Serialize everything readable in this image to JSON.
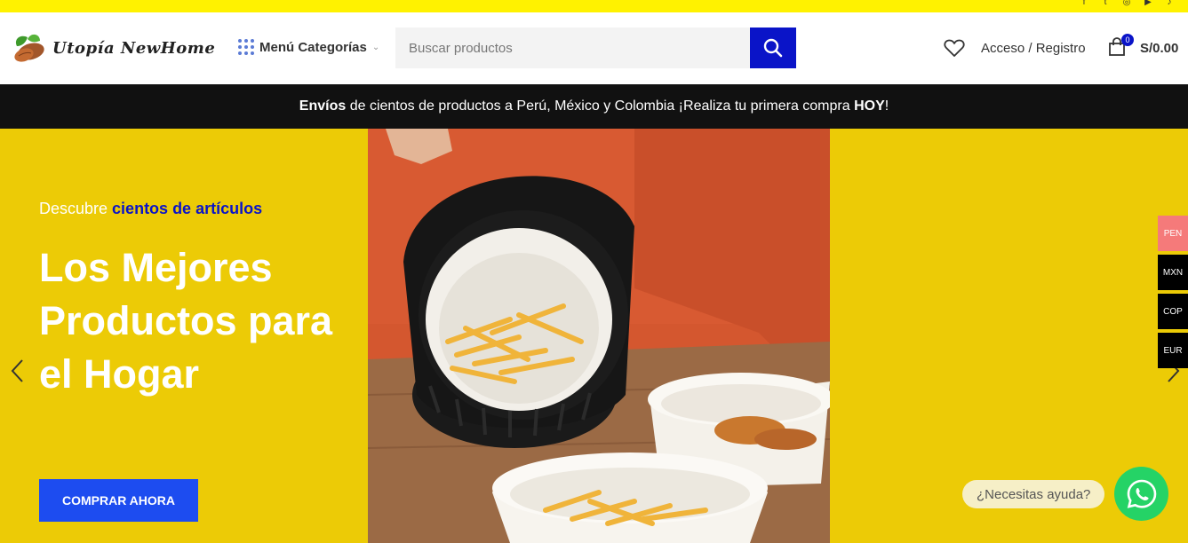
{
  "topbar": {
    "social_icons": [
      "facebook-icon",
      "twitter-icon",
      "instagram-icon",
      "youtube-icon",
      "tiktok-icon"
    ],
    "background": "#fff200"
  },
  "header": {
    "logo_text": "Utopía NewHome",
    "menu_label": "Menú Categorías",
    "search_placeholder": "Buscar productos",
    "login_label": "Acceso / Registro",
    "cart_count": "0",
    "cart_total": "S/0.00",
    "accent": "#0a14c8"
  },
  "promo": {
    "strong_start": "Envíos",
    "middle": " de cientos de productos a Perú, México y Colombia ¡Realiza tu primera compra ",
    "strong_end": "HOY",
    "tail": "!"
  },
  "hero": {
    "kicker_plain": "Descubre ",
    "kicker_highlight": "cientos de artículos",
    "title": "Los Mejores Productos para el Hogar",
    "cta_label": "COMPRAR AHORA",
    "background": "#eccb06"
  },
  "currencies": [
    {
      "code": "PEN",
      "color": "#f57a7a"
    },
    {
      "code": "MXN",
      "color": "#000000"
    },
    {
      "code": "COP",
      "color": "#000000"
    },
    {
      "code": "EUR",
      "color": "#000000"
    }
  ],
  "chat": {
    "help_text": "¿Necesitas ayuda?",
    "whatsapp_color": "#25d366"
  }
}
